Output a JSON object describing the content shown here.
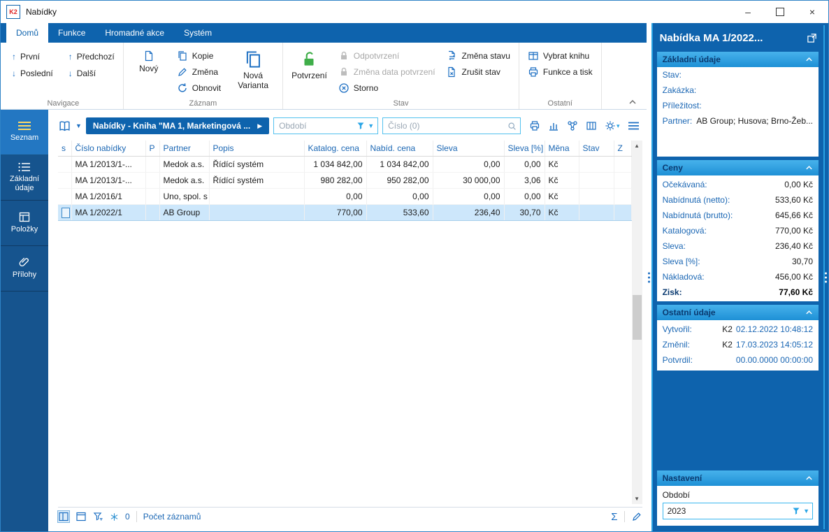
{
  "window": {
    "title": "Nabídky",
    "logo_text": "K2",
    "controls": {
      "minimize": "–",
      "close": "×"
    }
  },
  "ribbon": {
    "tabs": [
      {
        "label": "Domů",
        "active": true
      },
      {
        "label": "Funkce",
        "active": false
      },
      {
        "label": "Hromadné akce",
        "active": false
      },
      {
        "label": "Systém",
        "active": false
      }
    ],
    "groups": {
      "navigace": {
        "label": "Navigace",
        "prvni": "První",
        "posledni": "Poslední",
        "predchozi": "Předchozí",
        "dalsi": "Další"
      },
      "zaznam": {
        "label": "Záznam",
        "novy": "Nový",
        "kopie": "Kopie",
        "zmena": "Změna",
        "obnovit": "Obnovit",
        "nova_varianta": "Nová Varianta"
      },
      "stav": {
        "label": "Stav",
        "potvrzeni": "Potvrzení",
        "odpotvrzeni": "Odpotvrzení",
        "zmena_data_potvrzeni": "Změna data potvrzení",
        "storno": "Storno",
        "zmena_stavu": "Změna stavu",
        "zrusit_stav": "Zrušit stav"
      },
      "ostatni": {
        "label": "Ostatní",
        "vybrat_knihu": "Vybrat knihu",
        "funkce_a_tisk": "Funkce a tisk"
      }
    }
  },
  "sidebar": {
    "items": [
      {
        "label": "Seznam",
        "active": true
      },
      {
        "label": "Základní údaje",
        "active": false
      },
      {
        "label": "Položky",
        "active": false
      },
      {
        "label": "Přílohy",
        "active": false
      }
    ]
  },
  "content": {
    "toolbar": {
      "book_title": "Nabídky - Kniha \"MA 1, Marketingová ...",
      "play_glyph": "▶",
      "period_placeholder": "Období",
      "search_placeholder": "Číslo (0)"
    },
    "table": {
      "columns": [
        "s",
        "Číslo nabídky",
        "P",
        "Partner",
        "Popis",
        "Katalog. cena",
        "Nabíd. cena",
        "Sleva",
        "Sleva [%]",
        "Měna",
        "Stav",
        "Z"
      ],
      "rows": [
        {
          "cislo_nabidky": "MA 1/2013/1-...",
          "partner": "Medok a.s.",
          "popis": "Řídící systém",
          "katalog_cena": "1 034 842,00",
          "nabid_cena": "1 034 842,00",
          "sleva": "0,00",
          "sleva_pct": "0,00",
          "mena": "Kč",
          "stav": "",
          "z": ""
        },
        {
          "cislo_nabidky": "MA 1/2013/1-...",
          "partner": "Medok a.s.",
          "popis": "Řídící systém",
          "katalog_cena": "980 282,00",
          "nabid_cena": "950 282,00",
          "sleva": "30 000,00",
          "sleva_pct": "3,06",
          "mena": "Kč",
          "stav": "",
          "z": ""
        },
        {
          "cislo_nabidky": "MA 1/2016/1",
          "partner": "Uno, spol. s r...",
          "popis": "",
          "katalog_cena": "0,00",
          "nabid_cena": "0,00",
          "sleva": "0,00",
          "sleva_pct": "0,00",
          "mena": "Kč",
          "stav": "",
          "z": ""
        },
        {
          "cislo_nabidky": "MA 1/2022/1",
          "partner": "AB Group",
          "popis": "",
          "katalog_cena": "770,00",
          "nabid_cena": "533,60",
          "sleva": "236,40",
          "sleva_pct": "30,70",
          "mena": "Kč",
          "stav": "",
          "z": "",
          "selected": true
        }
      ]
    },
    "statusbar": {
      "frozen_count": "0",
      "records_label": "Počet záznamů",
      "sum_symbol": "Σ"
    }
  },
  "panel": {
    "title": "Nabídka MA 1/2022...",
    "zakladni_udaje": {
      "title": "Základní údaje",
      "fields": [
        {
          "label": "Stav:",
          "value": ""
        },
        {
          "label": "Zakázka:",
          "value": ""
        },
        {
          "label": "Příležitost:",
          "value": ""
        },
        {
          "label": "Partner:",
          "value": "AB Group; Husova; Brno-Žeb..."
        }
      ]
    },
    "ceny": {
      "title": "Ceny",
      "fields": [
        {
          "label": "Očekávaná:",
          "value": "0,00 Kč"
        },
        {
          "label": "Nabídnutá (netto):",
          "value": "533,60 Kč"
        },
        {
          "label": "Nabídnutá (brutto):",
          "value": "645,66 Kč"
        },
        {
          "label": "Katalogová:",
          "value": "770,00 Kč"
        },
        {
          "label": "Sleva:",
          "value": "236,40 Kč"
        },
        {
          "label": "Sleva [%]:",
          "value": "30,70"
        },
        {
          "label": "Nákladová:",
          "value": "456,00 Kč"
        },
        {
          "label": "Zisk:",
          "value": "77,60 Kč"
        }
      ]
    },
    "ostatni_udaje": {
      "title": "Ostatní údaje",
      "fields": [
        {
          "label": "Vytvořil:",
          "user": "K2",
          "value": "02.12.2022 10:48:12"
        },
        {
          "label": "Změnil:",
          "user": "K2",
          "value": "17.03.2023 14:05:12"
        },
        {
          "label": "Potvrdil:",
          "user": "",
          "value": "00.00.0000 00:00:00"
        }
      ]
    },
    "nastaveni": {
      "title": "Nastavení",
      "period_label": "Období",
      "period_value": "2023"
    }
  },
  "colors": {
    "primary_blue": "#0e63ad",
    "accent_cyan": "#29a3e3",
    "section_header_blue": "#2b9fe0",
    "selected_row": "#cde7fb",
    "label_blue": "#1b67b4",
    "confirm_green": "#3fae49"
  }
}
